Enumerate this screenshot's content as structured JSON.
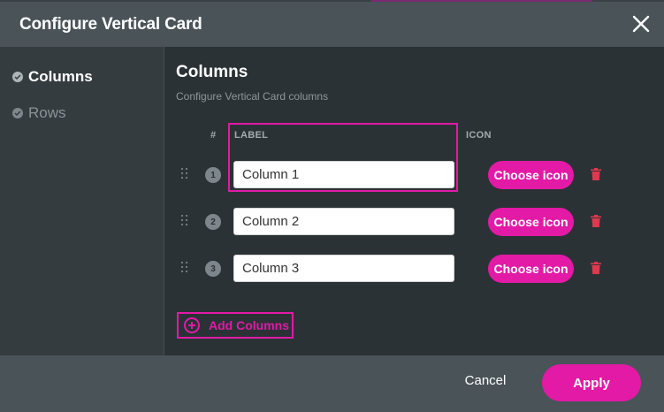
{
  "modal": {
    "title": "Configure Vertical Card",
    "close_icon": "close-icon"
  },
  "sidebar": {
    "items": [
      {
        "label": "Columns",
        "active": true,
        "icon": "check-circle-icon"
      },
      {
        "label": "Rows",
        "active": false,
        "icon": "check-circle-icon"
      }
    ]
  },
  "main": {
    "title": "Columns",
    "subtitle": "Configure Vertical Card columns",
    "headers": {
      "number": "#",
      "label": "LABEL",
      "icon": "ICON"
    },
    "rows": [
      {
        "index": "1",
        "label": "Column 1",
        "icon_button": "Choose icon"
      },
      {
        "index": "2",
        "label": "Column 2",
        "icon_button": "Choose icon"
      },
      {
        "index": "3",
        "label": "Column 3",
        "icon_button": "Choose icon"
      }
    ],
    "add_button": "Add Columns"
  },
  "footer": {
    "cancel": "Cancel",
    "apply": "Apply"
  },
  "colors": {
    "accent": "#e21aa6",
    "header_bg": "#4a5358",
    "panel_bg": "#2b3236",
    "sidebar_bg": "#353c40",
    "delete": "#e0384f"
  }
}
